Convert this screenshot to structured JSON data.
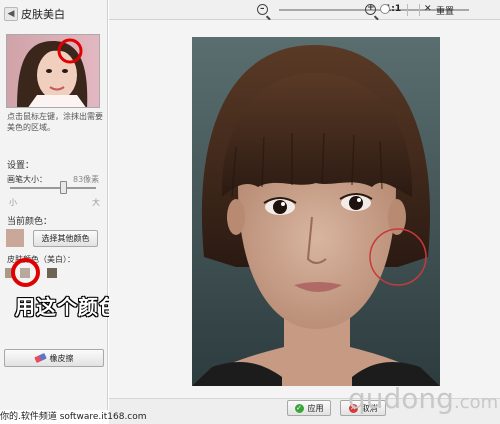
{
  "panel": {
    "back_label": "◀",
    "title": "皮肤美白",
    "hint": "点击鼠标左键，涂抹出需要美色的区域。",
    "settings_label": "设置：",
    "brush_size_label": "画笔大小：",
    "brush_size_value": "83像素",
    "slider_min": "小",
    "slider_max": "大",
    "slider_level": 0.62,
    "current_color_label": "当前颜色：",
    "current_color": "#c9a89a",
    "choose_color_button": "选择其他颜色",
    "skin_color_label": "皮肤颜色（美白）：",
    "preset_colors": [
      "#a89a88",
      "#b7a99c",
      "#6e6456"
    ],
    "eraser_button": "橡皮擦"
  },
  "annotation": {
    "overlay_text": "用这个颜色美白皮肤",
    "ring_color": "#e00000"
  },
  "toolbar": {
    "zoom_level": 0.56,
    "actual_size": "1:1",
    "reset_icon": "x-close-icon",
    "reset_label": "重置"
  },
  "actions": {
    "apply_label": "应用",
    "cancel_label": "取消"
  },
  "watermark": {
    "main": "qudong",
    "suffix": ".com"
  },
  "footer": {
    "credit": "你的.软件频道 software.it168.com"
  }
}
